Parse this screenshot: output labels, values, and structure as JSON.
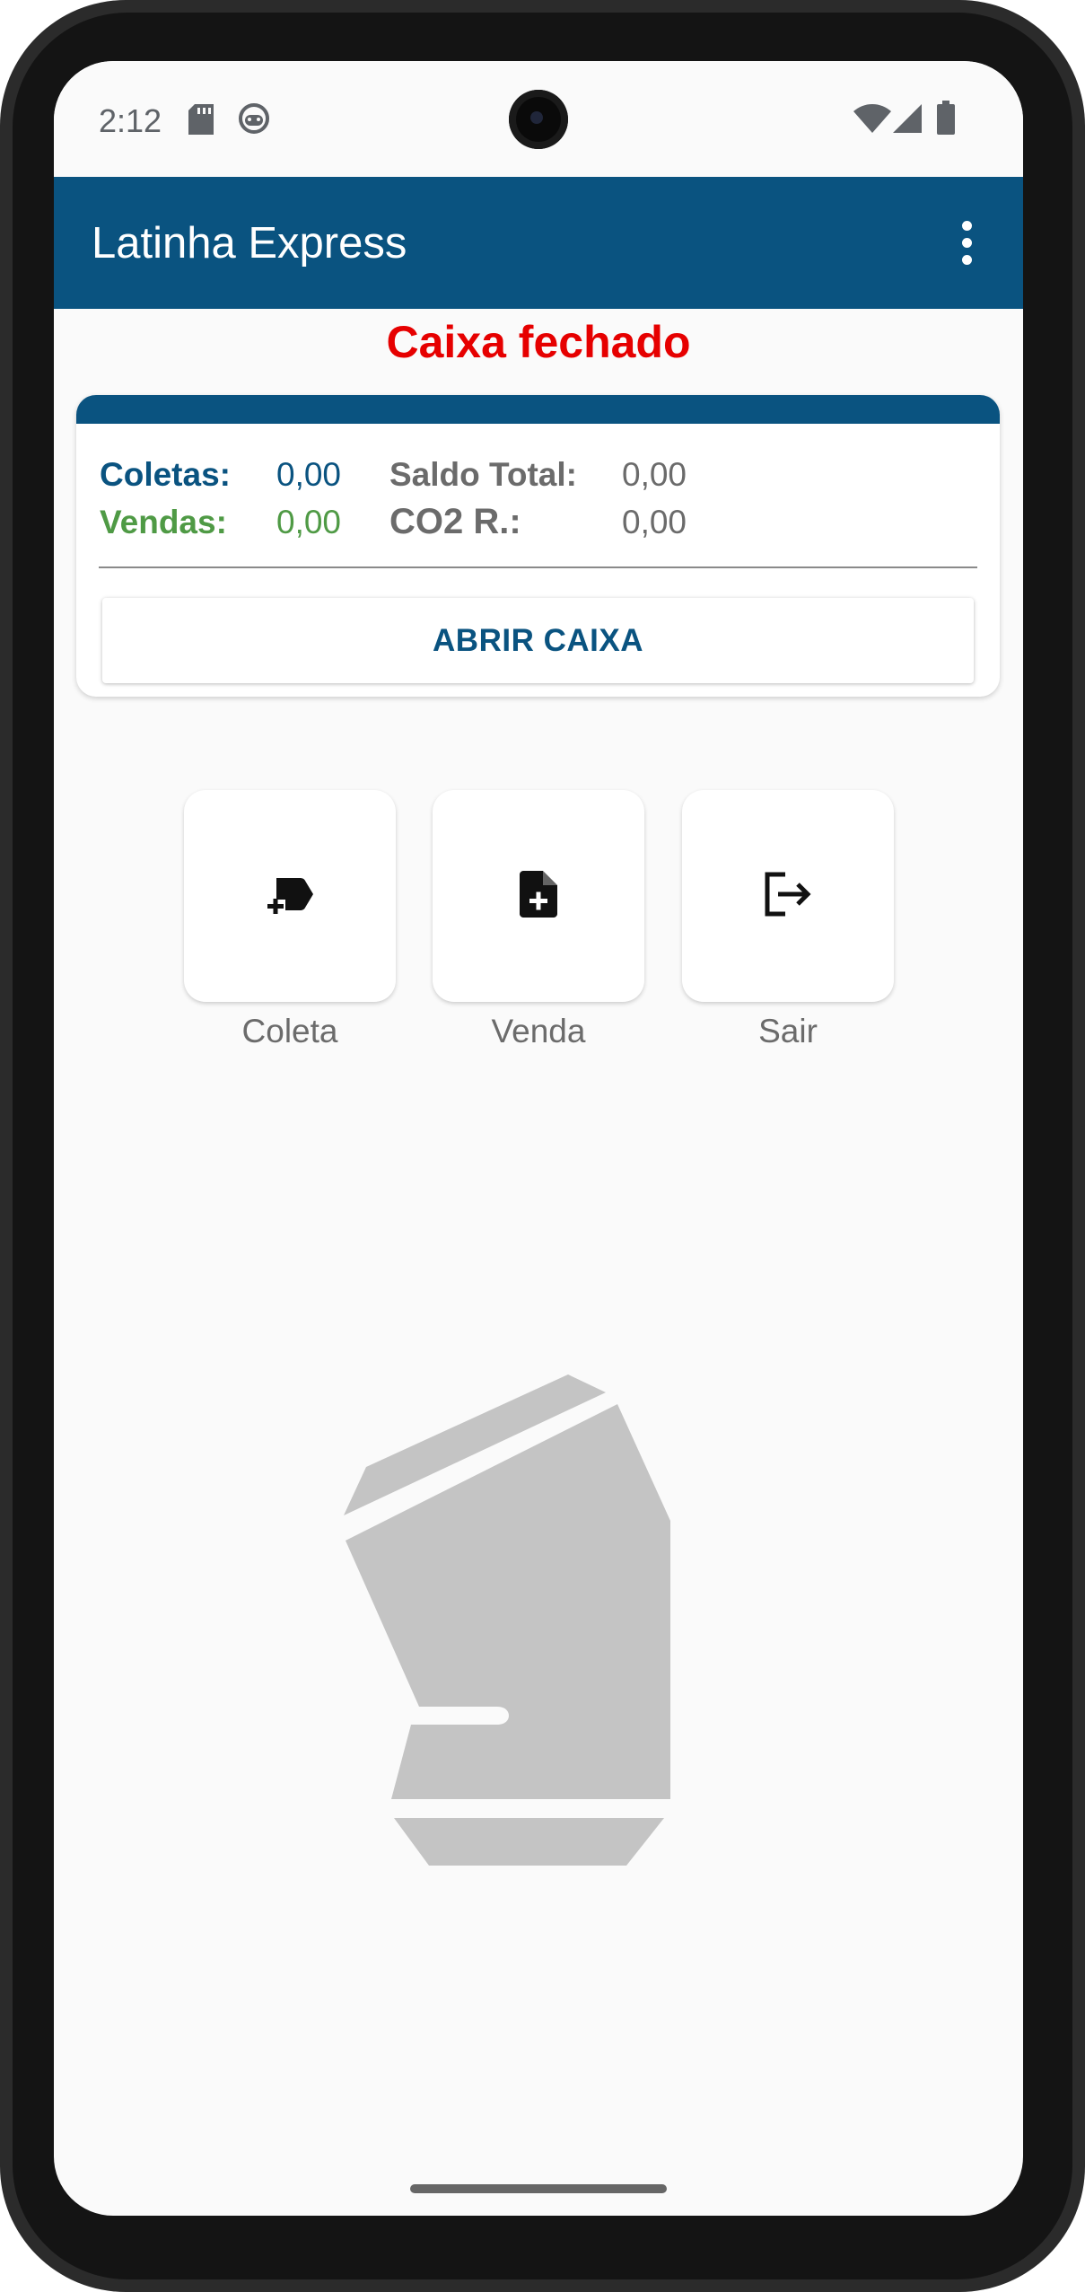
{
  "status_bar": {
    "time": "2:12",
    "icons": [
      "sd-card-icon",
      "android-debug-icon",
      "wifi-icon",
      "signal-icon",
      "battery-icon"
    ]
  },
  "app_bar": {
    "title": "Latinha Express",
    "overflow_icon": "more-vert-icon"
  },
  "caixa_status": "Caixa fechado",
  "summary": {
    "coletas_label": "Coletas:",
    "coletas_value": "0,00",
    "vendas_label": "Vendas:",
    "vendas_value": "0,00",
    "saldo_label": "Saldo Total:",
    "saldo_value": "0,00",
    "co2_label": "CO2 R.:",
    "co2_value": "0,00"
  },
  "abrir_caixa_label": "ABRIR CAIXA",
  "actions": [
    {
      "label": "Coleta",
      "icon": "label-add-icon"
    },
    {
      "label": "Venda",
      "icon": "note-add-icon"
    },
    {
      "label": "Sair",
      "icon": "logout-icon"
    }
  ],
  "colors": {
    "primary": "#0a5380",
    "status_closed": "#e60000",
    "vendas": "#4f9a45",
    "muted": "#6b6b6b",
    "logo": "#c4c4c4"
  }
}
